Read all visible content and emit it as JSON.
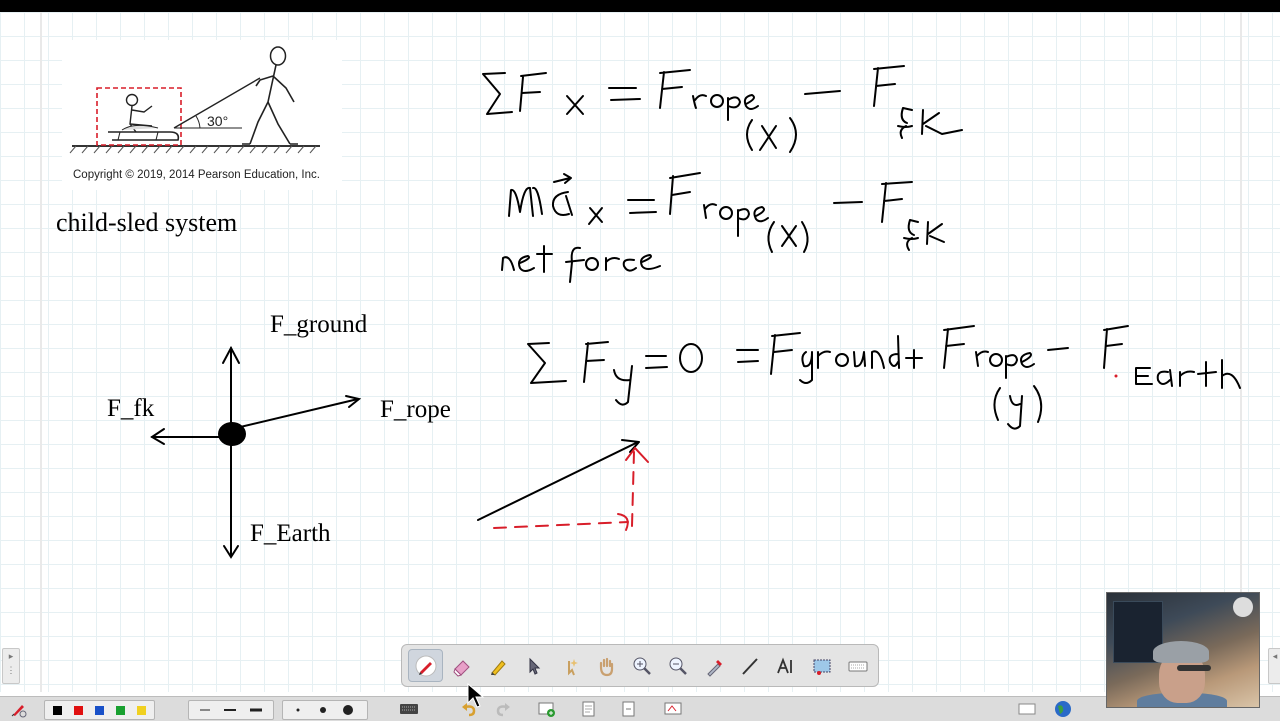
{
  "figure": {
    "angle_label": "30°",
    "copyright": "Copyright © 2019, 2014  Pearson Education, Inc.",
    "caption": "child-sled system"
  },
  "fbd": {
    "ground_label": "F_ground",
    "fk_label": "F_fk",
    "rope_label": "F_rope",
    "earth_label": "F_Earth"
  },
  "toolbar": {
    "tools": [
      "pen",
      "eraser",
      "highlighter",
      "select",
      "magic-select",
      "pan",
      "zoom-in",
      "zoom-out",
      "fill",
      "line",
      "text",
      "screen-capture",
      "keyboard"
    ],
    "active_tool": "pen"
  },
  "bottombar": {
    "colors": [
      "#000000",
      "#e01010",
      "#1850c8",
      "#18a030",
      "#f0d020"
    ],
    "line_widths": [
      "thin",
      "medium",
      "thick"
    ],
    "dot_sizes": [
      "small",
      "medium",
      "large"
    ]
  },
  "accent": {
    "ink": "#000000",
    "red_ink": "#d81e2a"
  }
}
